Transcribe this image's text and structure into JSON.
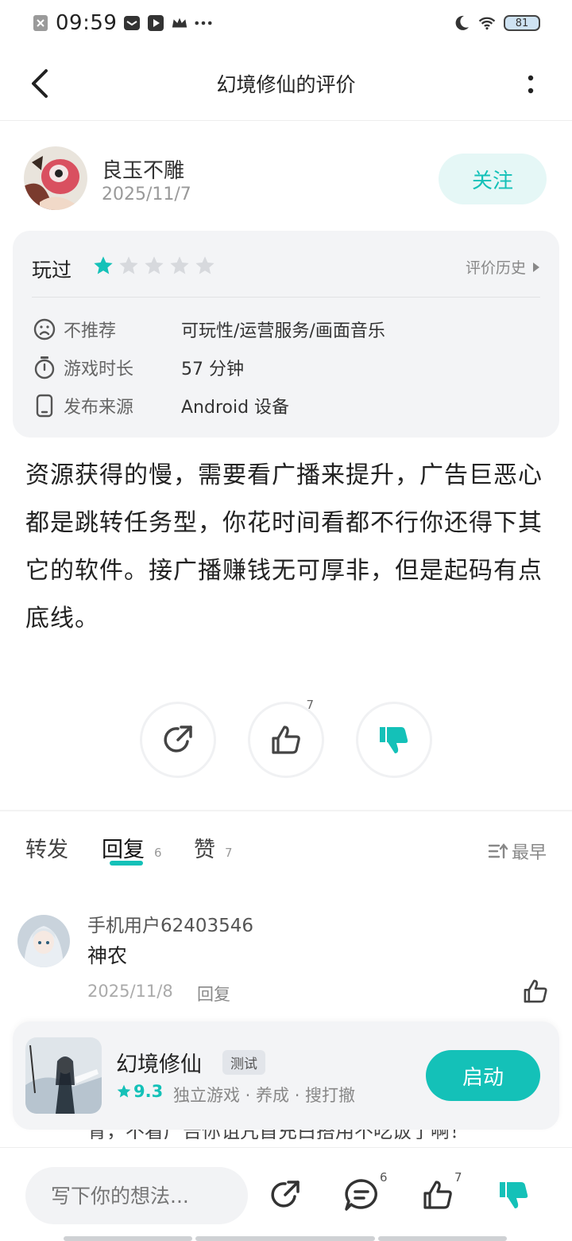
{
  "status_bar": {
    "time": "09:59",
    "battery": "81"
  },
  "nav": {
    "title": "幻境修仙的评价"
  },
  "author": {
    "name": "良玉不雕",
    "date": "2025/11/7",
    "follow_label": "关注"
  },
  "rating": {
    "played_label": "玩过",
    "stars": 1,
    "max_stars": 5,
    "history_label": "评价历史",
    "rows": [
      {
        "icon": "sad-face-icon",
        "label": "不推荐",
        "value": "可玩性/运营服务/画面音乐"
      },
      {
        "icon": "stopwatch-icon",
        "label": "游戏时长",
        "value": "57 分钟"
      },
      {
        "icon": "phone-icon",
        "label": "发布来源",
        "value": "Android 设备"
      }
    ]
  },
  "review": {
    "text": "资源获得的慢，需要看广播来提升，广告巨恶心都是跳转任务型，你花时间看都不行你还得下其它的软件。接广播赚钱无可厚非，但是起码有点底线。"
  },
  "actions": {
    "like_count": "7"
  },
  "tabs": {
    "forward": "转发",
    "reply": "回复",
    "reply_count": "6",
    "like": "赞",
    "like_count": "7",
    "sort": "最早"
  },
  "comment": {
    "user": "手机用户62403546",
    "text": "神农",
    "date": "2025/11/8",
    "reply_label": "回复"
  },
  "overflow_line": "青，不看广告你诅咒首充白搭用不吃饭了啊！",
  "game": {
    "name": "幻境修仙",
    "tag": "测试",
    "score": "9.3",
    "genres": "独立游戏 · 养成 · 搜打撤",
    "launch_label": "启动"
  },
  "bottom_bar": {
    "input_placeholder": "写下你的想法...",
    "comment_count": "6",
    "like_count": "7"
  },
  "colors": {
    "accent": "#14c1b8",
    "accent_light": "#e5f7f6",
    "card_bg": "#f3f4f6"
  }
}
